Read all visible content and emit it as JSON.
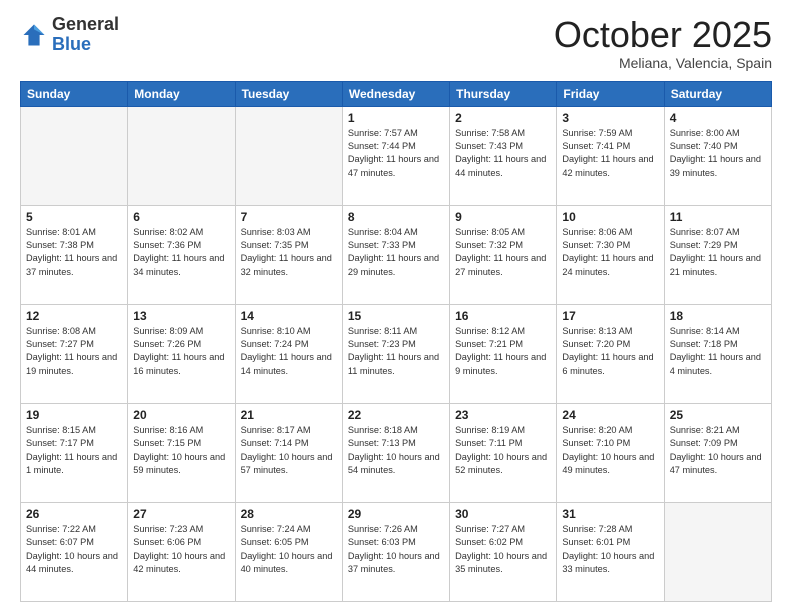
{
  "logo": {
    "general": "General",
    "blue": "Blue"
  },
  "header": {
    "month": "October 2025",
    "location": "Meliana, Valencia, Spain"
  },
  "days_of_week": [
    "Sunday",
    "Monday",
    "Tuesday",
    "Wednesday",
    "Thursday",
    "Friday",
    "Saturday"
  ],
  "weeks": [
    [
      {
        "day": "",
        "info": ""
      },
      {
        "day": "",
        "info": ""
      },
      {
        "day": "",
        "info": ""
      },
      {
        "day": "1",
        "info": "Sunrise: 7:57 AM\nSunset: 7:44 PM\nDaylight: 11 hours\nand 47 minutes."
      },
      {
        "day": "2",
        "info": "Sunrise: 7:58 AM\nSunset: 7:43 PM\nDaylight: 11 hours\nand 44 minutes."
      },
      {
        "day": "3",
        "info": "Sunrise: 7:59 AM\nSunset: 7:41 PM\nDaylight: 11 hours\nand 42 minutes."
      },
      {
        "day": "4",
        "info": "Sunrise: 8:00 AM\nSunset: 7:40 PM\nDaylight: 11 hours\nand 39 minutes."
      }
    ],
    [
      {
        "day": "5",
        "info": "Sunrise: 8:01 AM\nSunset: 7:38 PM\nDaylight: 11 hours\nand 37 minutes."
      },
      {
        "day": "6",
        "info": "Sunrise: 8:02 AM\nSunset: 7:36 PM\nDaylight: 11 hours\nand 34 minutes."
      },
      {
        "day": "7",
        "info": "Sunrise: 8:03 AM\nSunset: 7:35 PM\nDaylight: 11 hours\nand 32 minutes."
      },
      {
        "day": "8",
        "info": "Sunrise: 8:04 AM\nSunset: 7:33 PM\nDaylight: 11 hours\nand 29 minutes."
      },
      {
        "day": "9",
        "info": "Sunrise: 8:05 AM\nSunset: 7:32 PM\nDaylight: 11 hours\nand 27 minutes."
      },
      {
        "day": "10",
        "info": "Sunrise: 8:06 AM\nSunset: 7:30 PM\nDaylight: 11 hours\nand 24 minutes."
      },
      {
        "day": "11",
        "info": "Sunrise: 8:07 AM\nSunset: 7:29 PM\nDaylight: 11 hours\nand 21 minutes."
      }
    ],
    [
      {
        "day": "12",
        "info": "Sunrise: 8:08 AM\nSunset: 7:27 PM\nDaylight: 11 hours\nand 19 minutes."
      },
      {
        "day": "13",
        "info": "Sunrise: 8:09 AM\nSunset: 7:26 PM\nDaylight: 11 hours\nand 16 minutes."
      },
      {
        "day": "14",
        "info": "Sunrise: 8:10 AM\nSunset: 7:24 PM\nDaylight: 11 hours\nand 14 minutes."
      },
      {
        "day": "15",
        "info": "Sunrise: 8:11 AM\nSunset: 7:23 PM\nDaylight: 11 hours\nand 11 minutes."
      },
      {
        "day": "16",
        "info": "Sunrise: 8:12 AM\nSunset: 7:21 PM\nDaylight: 11 hours\nand 9 minutes."
      },
      {
        "day": "17",
        "info": "Sunrise: 8:13 AM\nSunset: 7:20 PM\nDaylight: 11 hours\nand 6 minutes."
      },
      {
        "day": "18",
        "info": "Sunrise: 8:14 AM\nSunset: 7:18 PM\nDaylight: 11 hours\nand 4 minutes."
      }
    ],
    [
      {
        "day": "19",
        "info": "Sunrise: 8:15 AM\nSunset: 7:17 PM\nDaylight: 11 hours\nand 1 minute."
      },
      {
        "day": "20",
        "info": "Sunrise: 8:16 AM\nSunset: 7:15 PM\nDaylight: 10 hours\nand 59 minutes."
      },
      {
        "day": "21",
        "info": "Sunrise: 8:17 AM\nSunset: 7:14 PM\nDaylight: 10 hours\nand 57 minutes."
      },
      {
        "day": "22",
        "info": "Sunrise: 8:18 AM\nSunset: 7:13 PM\nDaylight: 10 hours\nand 54 minutes."
      },
      {
        "day": "23",
        "info": "Sunrise: 8:19 AM\nSunset: 7:11 PM\nDaylight: 10 hours\nand 52 minutes."
      },
      {
        "day": "24",
        "info": "Sunrise: 8:20 AM\nSunset: 7:10 PM\nDaylight: 10 hours\nand 49 minutes."
      },
      {
        "day": "25",
        "info": "Sunrise: 8:21 AM\nSunset: 7:09 PM\nDaylight: 10 hours\nand 47 minutes."
      }
    ],
    [
      {
        "day": "26",
        "info": "Sunrise: 7:22 AM\nSunset: 6:07 PM\nDaylight: 10 hours\nand 44 minutes."
      },
      {
        "day": "27",
        "info": "Sunrise: 7:23 AM\nSunset: 6:06 PM\nDaylight: 10 hours\nand 42 minutes."
      },
      {
        "day": "28",
        "info": "Sunrise: 7:24 AM\nSunset: 6:05 PM\nDaylight: 10 hours\nand 40 minutes."
      },
      {
        "day": "29",
        "info": "Sunrise: 7:26 AM\nSunset: 6:03 PM\nDaylight: 10 hours\nand 37 minutes."
      },
      {
        "day": "30",
        "info": "Sunrise: 7:27 AM\nSunset: 6:02 PM\nDaylight: 10 hours\nand 35 minutes."
      },
      {
        "day": "31",
        "info": "Sunrise: 7:28 AM\nSunset: 6:01 PM\nDaylight: 10 hours\nand 33 minutes."
      },
      {
        "day": "",
        "info": ""
      }
    ]
  ]
}
